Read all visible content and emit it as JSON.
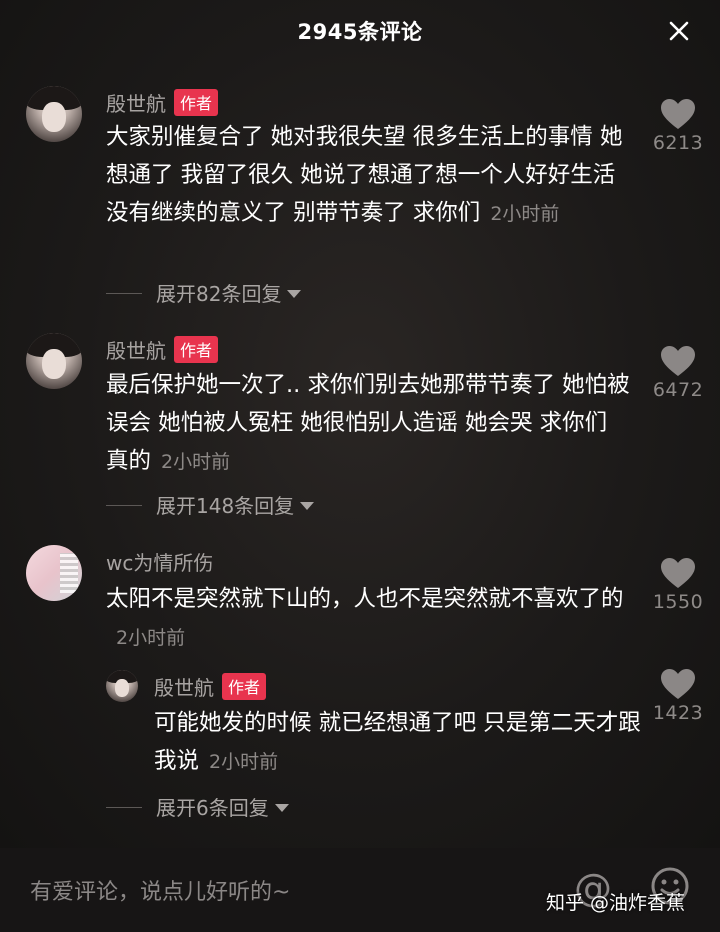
{
  "header": {
    "title": "2945条评论"
  },
  "comments": [
    {
      "user": "殷世航",
      "badge": "作者",
      "text": "大家别催复合了 她对我很失望 很多生活上的事情 她想通了 我留了很久 她说了想通了想一个人好好生活 没有继续的意义了 别带节奏了 求你们",
      "time": "2小时前",
      "likes": "6213",
      "expand": "展开82条回复"
    },
    {
      "user": "殷世航",
      "badge": "作者",
      "text": "最后保护她一次了.. 求你们别去她那带节奏了 她怕被误会 她怕被人冤枉 她很怕别人造谣 她会哭 求你们 真的",
      "time": "2小时前",
      "likes": "6472",
      "expand": "展开148条回复"
    },
    {
      "user": "wc为情所伤",
      "text": "太阳不是突然就下山的，人也不是突然就不喜欢了的",
      "time": "2小时前",
      "likes": "1550"
    }
  ],
  "reply": {
    "user": "殷世航",
    "badge": "作者",
    "text": "可能她发的时候 就已经想通了吧 只是第二天才跟我说",
    "time": "2小时前",
    "likes": "1423"
  },
  "reply_expand": "展开6条回复",
  "input": {
    "placeholder": "有爱评论，说点儿好听的~"
  },
  "watermark": "知乎 @油炸香蕉",
  "icons": {
    "close": "close-icon",
    "like": "heart-icon",
    "mention": "at-icon",
    "emoji": "emoji-icon"
  },
  "colors": {
    "badge": "#e8344e",
    "background": "#1c1a19"
  }
}
